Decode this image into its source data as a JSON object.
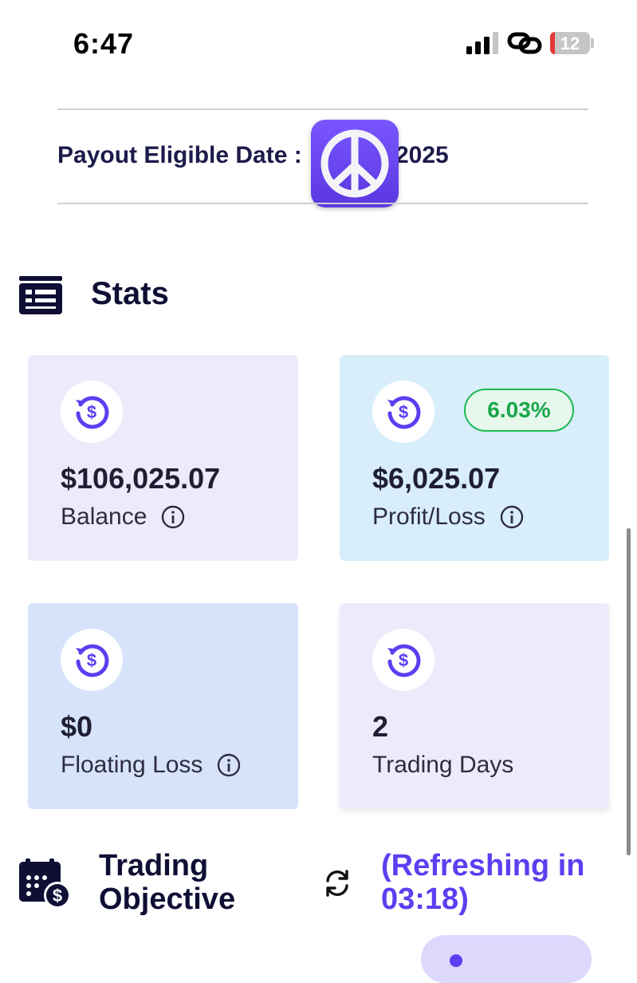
{
  "status_bar": {
    "time": "6:47",
    "battery": "12"
  },
  "payout": {
    "label": "Payout Eligible Date :",
    "date_visible_suffix": "2025"
  },
  "stats": {
    "title": "Stats",
    "cards": [
      {
        "value": "$106,025.07",
        "label": "Balance"
      },
      {
        "value": "$6,025.07",
        "label": "Profit/Loss",
        "badge": "6.03%"
      },
      {
        "value": "$0",
        "label": "Floating Loss"
      },
      {
        "value": "2",
        "label": "Trading Days"
      }
    ]
  },
  "trading_objective": {
    "title_line1": "Trading",
    "title_line2": "Objective",
    "refresh_line1": "(Refreshing in",
    "refresh_line2": "03:18)"
  },
  "colors": {
    "accent": "#5b3ff0",
    "positive": "#1aa64b",
    "card_lavender": "#ecebfc",
    "card_blue": "#d8eefa",
    "card_periwinkle": "#d6e3fb"
  }
}
